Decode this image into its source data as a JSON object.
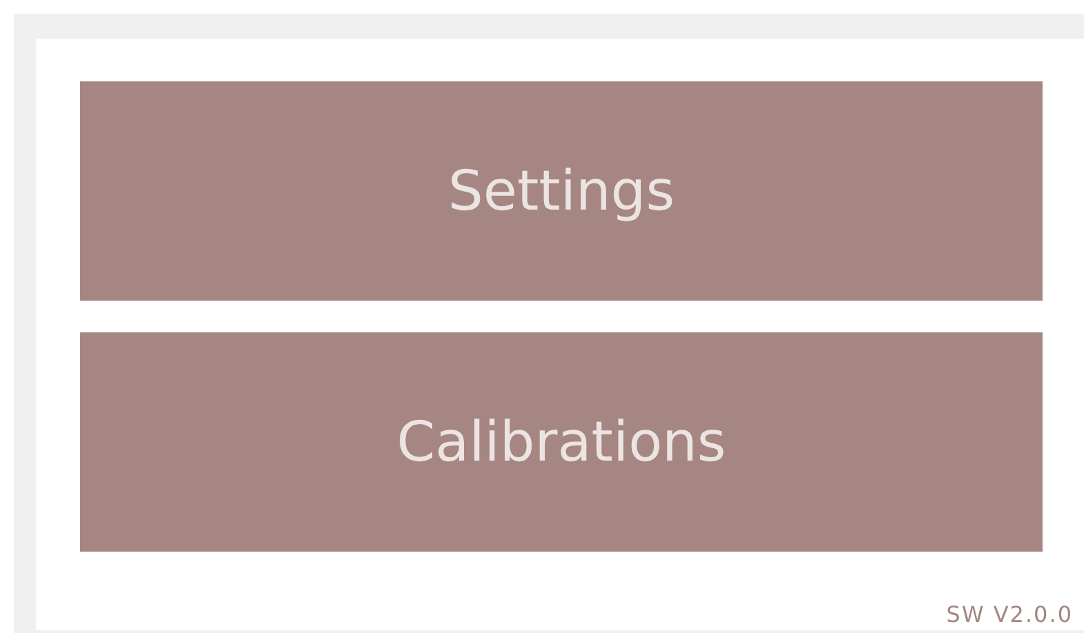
{
  "menu_buttons": [
    {
      "label": "Settings"
    },
    {
      "label": "Calibrations"
    }
  ],
  "version": "SW V2.0.0"
}
